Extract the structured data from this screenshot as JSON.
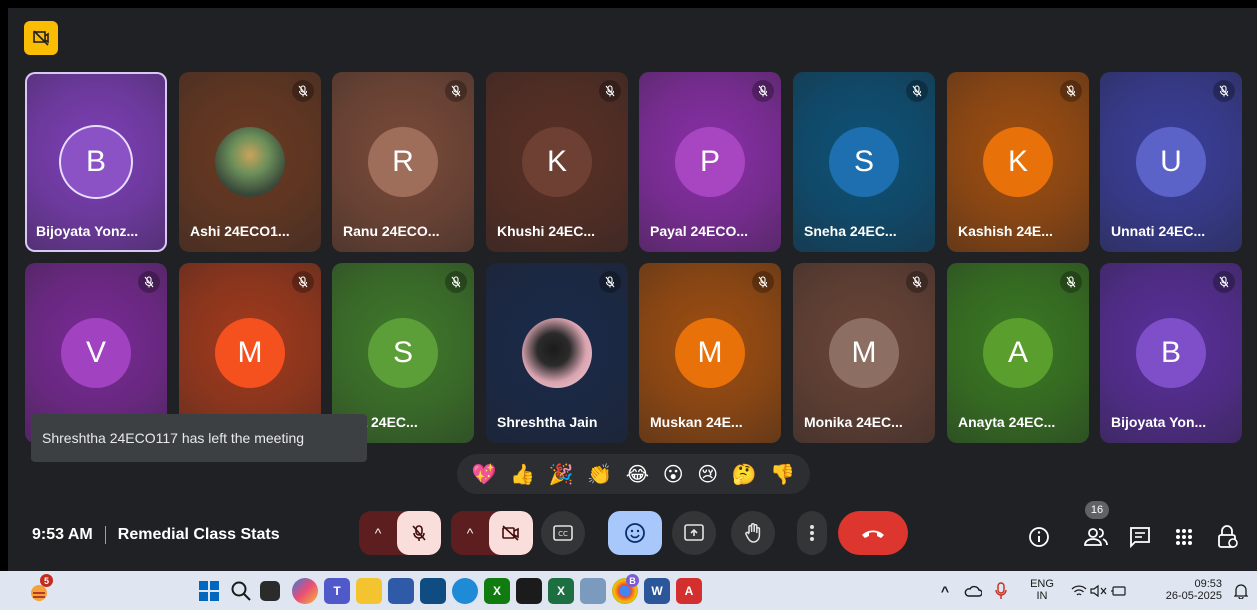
{
  "meeting": {
    "time": "9:53 AM",
    "title": "Remedial Class Stats",
    "participant_count": "16"
  },
  "toast": {
    "text": "Shreshtha 24ECO117 has left the meeting"
  },
  "reactions": [
    "💖",
    "👍",
    "🎉",
    "👏",
    "😂",
    "😮",
    "😢",
    "🤔",
    "👎"
  ],
  "tiles": [
    {
      "name": "Bijoyata Yonz...",
      "initial": "B",
      "bg": "#7e3fb8",
      "avatar": "#8a52c4",
      "active": true,
      "muted": false
    },
    {
      "name": "Ashi 24ECO1...",
      "initial": "",
      "bg": "#6b3a22",
      "avatar": "photo",
      "muted": true
    },
    {
      "name": "Ranu 24ECO...",
      "initial": "R",
      "bg": "#7a4a38",
      "avatar": "#9e6e5a",
      "muted": true
    },
    {
      "name": "Khushi 24EC...",
      "initial": "K",
      "bg": "#5a3024",
      "avatar": "#6e4034",
      "muted": true
    },
    {
      "name": "Payal 24ECO...",
      "initial": "P",
      "bg": "#8a2fa8",
      "avatar": "#a846c2",
      "muted": true
    },
    {
      "name": "Sneha 24EC...",
      "initial": "S",
      "bg": "#0d5278",
      "avatar": "#1d6fb0",
      "muted": true
    },
    {
      "name": "Kashish 24E...",
      "initial": "K",
      "bg": "#a04e10",
      "avatar": "#e8710a",
      "muted": true
    },
    {
      "name": "Unnati 24EC...",
      "initial": "U",
      "bg": "#3b3f9c",
      "avatar": "#5c63c8",
      "muted": true
    },
    {
      "name": "",
      "initial": "V",
      "bg": "#7a2a96",
      "avatar": "#a142c0",
      "muted": true
    },
    {
      "name": "",
      "initial": "M",
      "bg": "#a33a1c",
      "avatar": "#f4511e",
      "muted": true
    },
    {
      "name": "eha 24EC...",
      "initial": "S",
      "bg": "#3f7a2a",
      "avatar": "#5c9f38",
      "muted": true
    },
    {
      "name": "Shreshtha Jain",
      "initial": "",
      "bg": "#1a2a4a",
      "avatar": "photo2",
      "muted": true
    },
    {
      "name": "Muskan 24E...",
      "initial": "M",
      "bg": "#a04e10",
      "avatar": "#e8710a",
      "muted": true
    },
    {
      "name": "Monika 24EC...",
      "initial": "M",
      "bg": "#6a4436",
      "avatar": "#8d6e63",
      "muted": true
    },
    {
      "name": "Anayta 24EC...",
      "initial": "A",
      "bg": "#3a7a22",
      "avatar": "#5a9e2e",
      "muted": true
    },
    {
      "name": "Bijoyata Yon...",
      "initial": "B",
      "bg": "#5a2f9c",
      "avatar": "#7e4fc8",
      "muted": true
    }
  ],
  "taskbar": {
    "lang_top": "ENG",
    "lang_bottom": "IN",
    "clock_time": "09:53",
    "clock_date": "26-05-2025",
    "weather_badge": "5",
    "chrome_badge": "B"
  },
  "colors": {
    "end_call": "#dc362e",
    "accent": "#a8c7fa",
    "mute_red": "#f9dedc"
  }
}
